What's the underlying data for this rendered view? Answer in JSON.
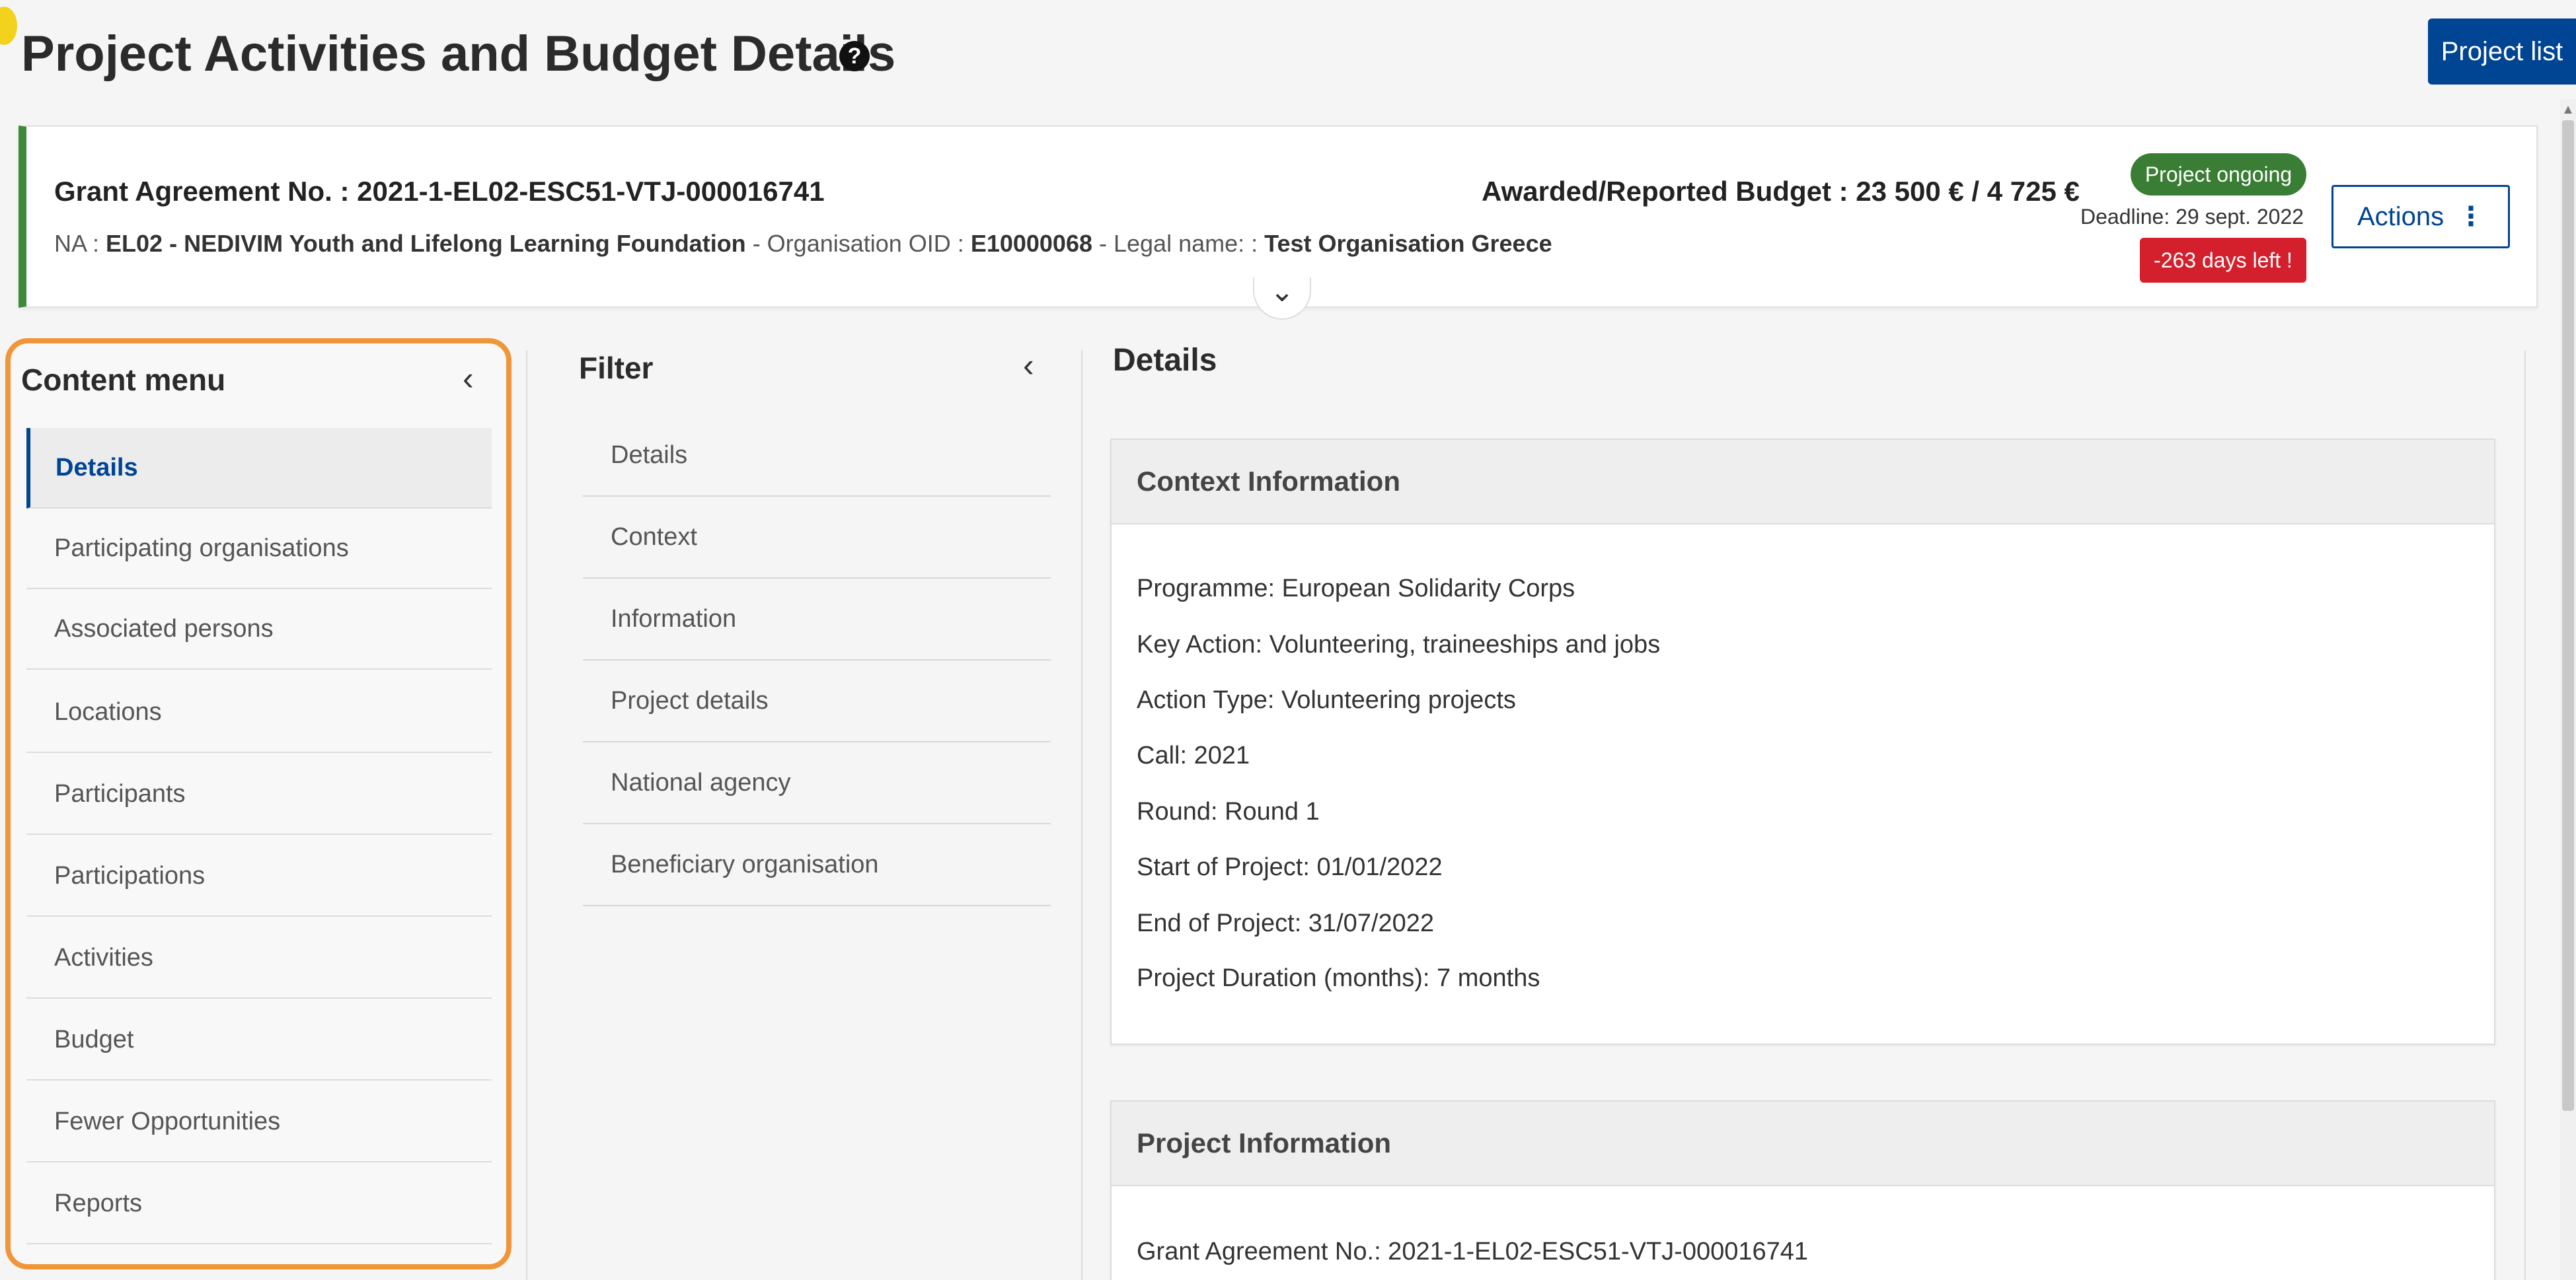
{
  "header": {
    "title": "Project Activities and Budget Details",
    "help_icon": "question-circle-icon",
    "project_list_label": "Project list"
  },
  "grant": {
    "agreement_label": "Grant Agreement No. : 2021-1-EL02-ESC51-VTJ-000016741",
    "na_label": "NA : ",
    "na_value": "EL02 - NEDIVIM Youth and Lifelong Learning Foundation",
    "oid_label": " - Organisation OID : ",
    "oid_value": "E10000068",
    "legal_label": " - Legal name: : ",
    "legal_value": "Test Organisation Greece",
    "budget_label": "Awarded/Reported Budget : 23 500 € / 4 725 €",
    "status": "Project ongoing",
    "status_color": "#3a7d34",
    "deadline": "Deadline: 29 sept. 2022",
    "days_left": "-263 days left !",
    "days_left_color": "#d4202c",
    "actions_label": "Actions",
    "actions_icon": "kebab-menu-icon",
    "expand_icon": "chevron-down-icon"
  },
  "content_menu": {
    "title": "Content menu",
    "collapse_icon": "chevron-left-icon",
    "items": [
      {
        "label": "Details",
        "active": true
      },
      {
        "label": "Participating organisations"
      },
      {
        "label": "Associated persons"
      },
      {
        "label": "Locations"
      },
      {
        "label": "Participants"
      },
      {
        "label": "Participations"
      },
      {
        "label": "Activities"
      },
      {
        "label": "Budget"
      },
      {
        "label": "Fewer Opportunities"
      },
      {
        "label": "Reports"
      }
    ]
  },
  "filter": {
    "title": "Filter",
    "collapse_icon": "chevron-left-icon",
    "items": [
      {
        "label": "Details"
      },
      {
        "label": "Context"
      },
      {
        "label": "Information"
      },
      {
        "label": "Project details"
      },
      {
        "label": "National agency"
      },
      {
        "label": "Beneficiary organisation"
      }
    ]
  },
  "details": {
    "heading": "Details",
    "context_card": {
      "title": "Context Information",
      "rows": [
        "Programme: European Solidarity Corps",
        "Key Action: Volunteering, traineeships and jobs",
        "Action Type: Volunteering projects",
        "Call: 2021",
        "Round: Round 1",
        "Start of Project: 01/01/2022",
        "End of Project: 31/07/2022",
        "Project Duration (months): 7 months"
      ]
    },
    "project_card": {
      "title": "Project Information",
      "rows": [
        "Grant Agreement No.: 2021-1-EL02-ESC51-VTJ-000016741"
      ]
    }
  },
  "colors": {
    "primary": "#004494",
    "highlight_outline": "#f0963a",
    "card_accent": "#3d8a3a"
  }
}
